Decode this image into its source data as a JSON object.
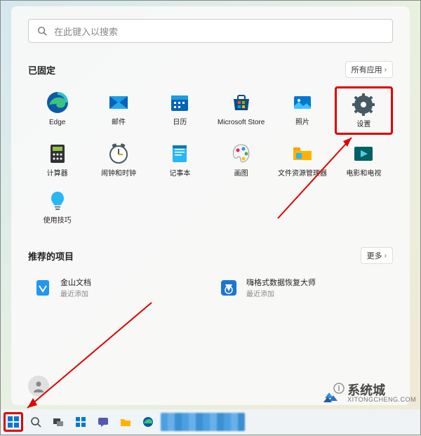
{
  "search": {
    "placeholder": "在此键入以搜索"
  },
  "pinned": {
    "title": "已固定",
    "all_apps": "所有应用",
    "apps": [
      {
        "label": "Edge"
      },
      {
        "label": "邮件"
      },
      {
        "label": "日历"
      },
      {
        "label": "Microsoft Store"
      },
      {
        "label": "照片"
      },
      {
        "label": "设置"
      },
      {
        "label": "计算器"
      },
      {
        "label": "闹钟和时钟"
      },
      {
        "label": "记事本"
      },
      {
        "label": "画图"
      },
      {
        "label": "文件资源管理器"
      },
      {
        "label": "电影和电视"
      },
      {
        "label": "使用技巧"
      }
    ]
  },
  "recommended": {
    "title": "推荐的项目",
    "more": "更多",
    "items": [
      {
        "title": "金山文档",
        "sub": "最近添加"
      },
      {
        "title": "嗨格式数据恢复大师",
        "sub": "最近添加"
      }
    ]
  },
  "watermark": {
    "main": "系统城",
    "sub": "XITONGCHENG.COM"
  }
}
